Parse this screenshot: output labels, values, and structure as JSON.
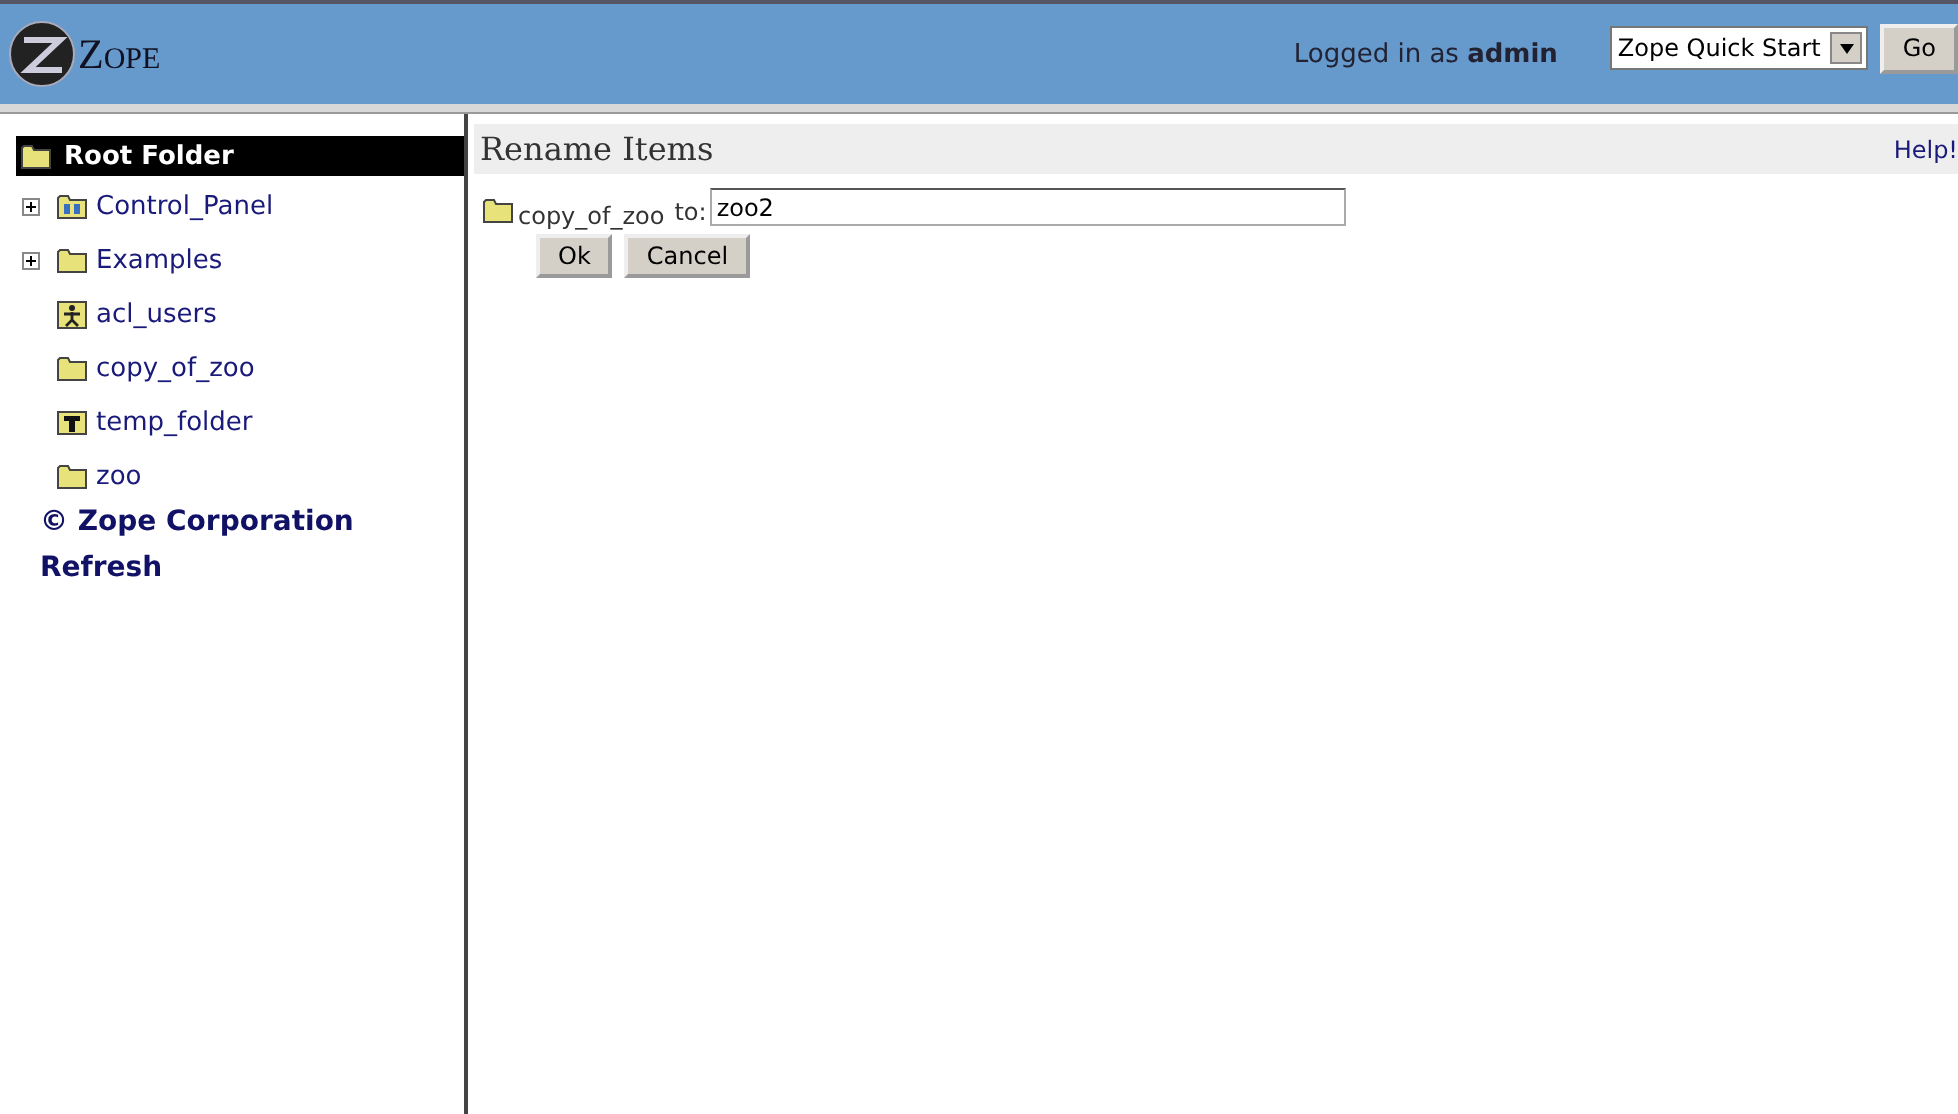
{
  "header": {
    "logo": "ZOPE",
    "login_label": "Logged in as",
    "user": "admin",
    "quick_select": "Zope Quick Start",
    "go_button": "Go"
  },
  "sidebar": {
    "root": "Root Folder",
    "items": [
      {
        "label": "Control_Panel",
        "kind": "control",
        "expandable": true
      },
      {
        "label": "Examples",
        "kind": "folder",
        "expandable": true
      },
      {
        "label": "acl_users",
        "kind": "users",
        "expandable": false
      },
      {
        "label": "copy_of_zoo",
        "kind": "folder",
        "expandable": false
      },
      {
        "label": "temp_folder",
        "kind": "temp",
        "expandable": false
      },
      {
        "label": "zoo",
        "kind": "folder",
        "expandable": false
      }
    ],
    "links": [
      "© Zope Corporation",
      "Refresh"
    ]
  },
  "main": {
    "title": "Rename Items",
    "help": "Help!",
    "item": "copy_of_zoo",
    "to_label": "to:",
    "new_name": "zoo2",
    "buttons": [
      "Ok",
      "Cancel"
    ]
  }
}
